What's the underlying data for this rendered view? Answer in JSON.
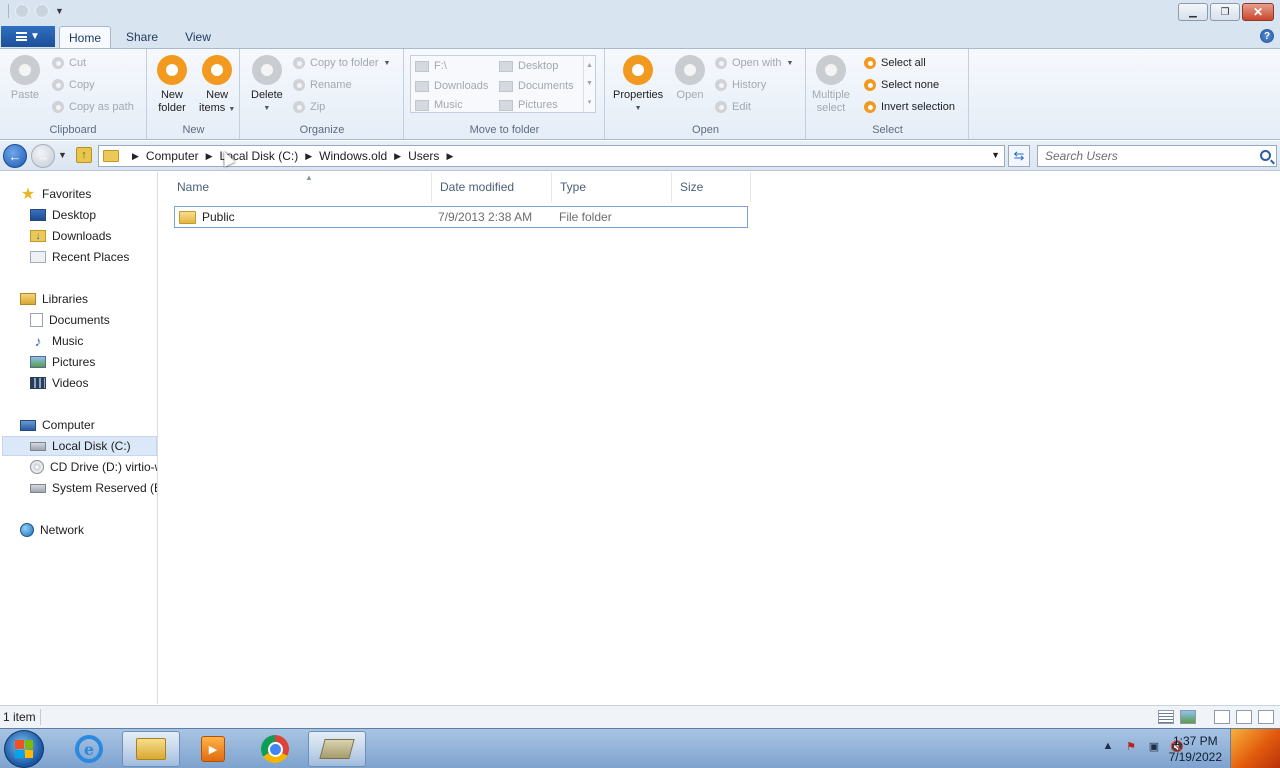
{
  "ribbon": {
    "tabs": [
      {
        "label": "Home",
        "active": true
      },
      {
        "label": "Share",
        "active": false
      },
      {
        "label": "View",
        "active": false
      }
    ],
    "clipboard": {
      "label": "Clipboard",
      "paste": "Paste",
      "cut": "Cut",
      "copy": "Copy",
      "copy_as_path": "Copy as path"
    },
    "new": {
      "label": "New",
      "new_folder_1": "New",
      "new_folder_2": "folder",
      "new_items_1": "New",
      "new_items_2": "items"
    },
    "organize": {
      "label": "Organize",
      "delete": "Delete",
      "copy_to_folder": "Copy to folder",
      "rename": "Rename",
      "zip": "Zip"
    },
    "move_to_folder": {
      "label": "Move to folder",
      "items": [
        "F:\\",
        "Desktop",
        "Downloads",
        "Documents",
        "Music",
        "Pictures"
      ]
    },
    "open": {
      "label": "Open",
      "properties": "Properties",
      "open": "Open",
      "open_with": "Open with",
      "history": "History",
      "edit": "Edit"
    },
    "select": {
      "label": "Select",
      "multiple_1": "Multiple",
      "multiple_2": "select",
      "select_all": "Select all",
      "select_none": "Select none",
      "invert_selection": "Invert selection"
    }
  },
  "address": {
    "breadcrumbs": [
      "Computer",
      "Local Disk (C:)",
      "Windows.old",
      "Users"
    ],
    "search_placeholder": "Search Users"
  },
  "nav": {
    "favorites": "Favorites",
    "favorites_items": [
      "Desktop",
      "Downloads",
      "Recent Places"
    ],
    "libraries": "Libraries",
    "libraries_items": [
      "Documents",
      "Music",
      "Pictures",
      "Videos"
    ],
    "computer": "Computer",
    "computer_items": [
      "Local Disk (C:)",
      "CD Drive (D:) virtio-w",
      "System Reserved (E:)"
    ],
    "network": "Network"
  },
  "content": {
    "columns": [
      "Name",
      "Date modified",
      "Type",
      "Size"
    ],
    "rows": [
      {
        "name": "Public",
        "date_modified": "7/9/2013 2:38 AM",
        "type": "File folder",
        "size": ""
      }
    ]
  },
  "status": {
    "item_count": "1 item"
  },
  "taskbar": {
    "time": "1:37 PM",
    "date": "7/19/2022"
  },
  "colors": {
    "accent": "#1c4f9a",
    "ribbon_orange": "#f29a1f",
    "selection": "#dbe8f8"
  }
}
